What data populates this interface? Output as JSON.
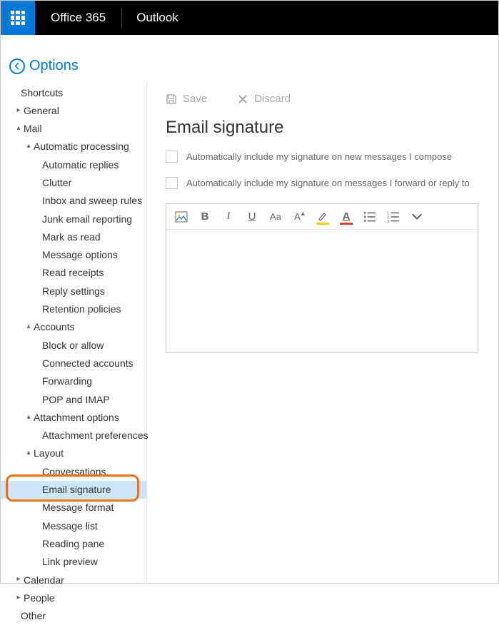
{
  "header": {
    "brand": "Office 365",
    "app": "Outlook"
  },
  "optionsBack": "Options",
  "sidebar": {
    "shortcuts": "Shortcuts",
    "general": "General",
    "mail": {
      "label": "Mail",
      "autoProcessing": {
        "label": "Automatic processing",
        "items": [
          "Automatic replies",
          "Clutter",
          "Inbox and sweep rules",
          "Junk email reporting",
          "Mark as read",
          "Message options",
          "Read receipts",
          "Reply settings",
          "Retention policies"
        ]
      },
      "accounts": {
        "label": "Accounts",
        "items": [
          "Block or allow",
          "Connected accounts",
          "Forwarding",
          "POP and IMAP"
        ]
      },
      "attachment": {
        "label": "Attachment options",
        "items": [
          "Attachment preferences"
        ]
      },
      "layout": {
        "label": "Layout",
        "items": [
          "Conversations",
          "Email signature",
          "Message format",
          "Message list",
          "Reading pane",
          "Link preview"
        ]
      }
    },
    "calendar": "Calendar",
    "people": "People",
    "other": "Other"
  },
  "actions": {
    "save": "Save",
    "discard": "Discard"
  },
  "page": {
    "title": "Email signature",
    "cb1": "Automatically include my signature on new messages I compose",
    "cb2": "Automatically include my signature on messages I forward or reply to"
  },
  "colors": {
    "highlightBar": "#ffcc00",
    "fontColorBar": "#d24726"
  }
}
